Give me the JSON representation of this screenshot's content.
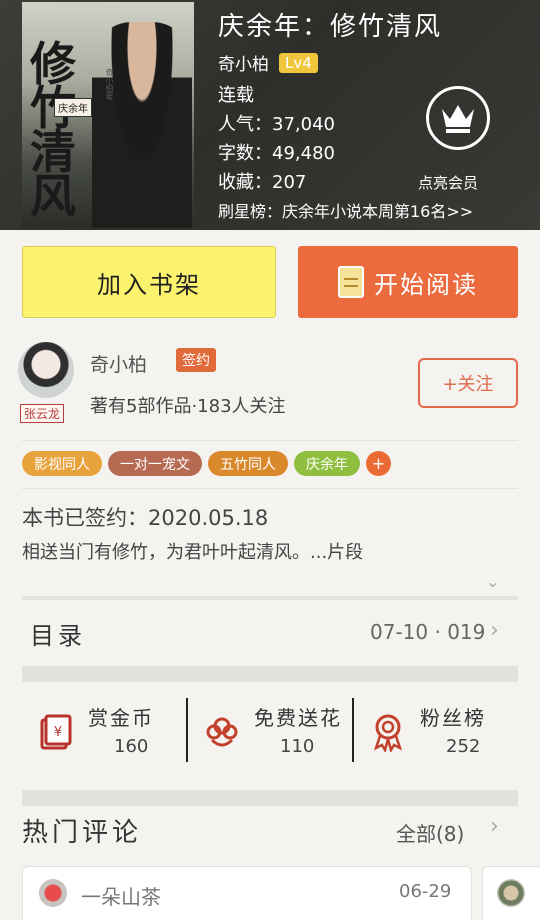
{
  "book": {
    "title": "庆余年：修竹清风",
    "author": "奇小柏",
    "level": "Lv4",
    "status": "连载",
    "popularity": "人气：37,040",
    "word_count": "字数：49,480",
    "favorites": "收藏：207",
    "rank": "刷星榜：庆余年小说本周第16名>>",
    "vip_label": "点亮会员",
    "cover_text": "修竹清风",
    "cover_sub": "庆余年",
    "cover_author": "奇小柏著"
  },
  "actions": {
    "add_shelf": "加入书架",
    "start_read": "开始阅读"
  },
  "author_card": {
    "name": "奇小柏",
    "signed_badge": "签约",
    "avatar_tag": "张云龙",
    "description": "著有5部作品·183人关注",
    "follow": "+关注"
  },
  "tags": [
    {
      "label": "影视同人",
      "color": "#e7a23c"
    },
    {
      "label": "一对一宠文",
      "color": "#b66a52"
    },
    {
      "label": "五竹同人",
      "color": "#d9892c"
    },
    {
      "label": "庆余年",
      "color": "#8fbf3f"
    },
    {
      "label": "+",
      "color": "#ec6a36"
    }
  ],
  "summary": {
    "signed_line": "本书已签约：2020.05.18",
    "intro": "相送当门有修竹，为君叶叶起清风。...片段"
  },
  "toc": {
    "label": "目录",
    "info": "07-10 · 019"
  },
  "stats": [
    {
      "label": "赏金币",
      "value": "160",
      "icon": "red-packet-icon"
    },
    {
      "label": "免费送花",
      "value": "110",
      "icon": "flower-icon"
    },
    {
      "label": "粉丝榜",
      "value": "252",
      "icon": "medal-icon"
    }
  ],
  "comments": {
    "title": "热门评论",
    "all": "全部(8)",
    "items": [
      {
        "user": "一朵山茶",
        "date": "06-29"
      }
    ]
  }
}
